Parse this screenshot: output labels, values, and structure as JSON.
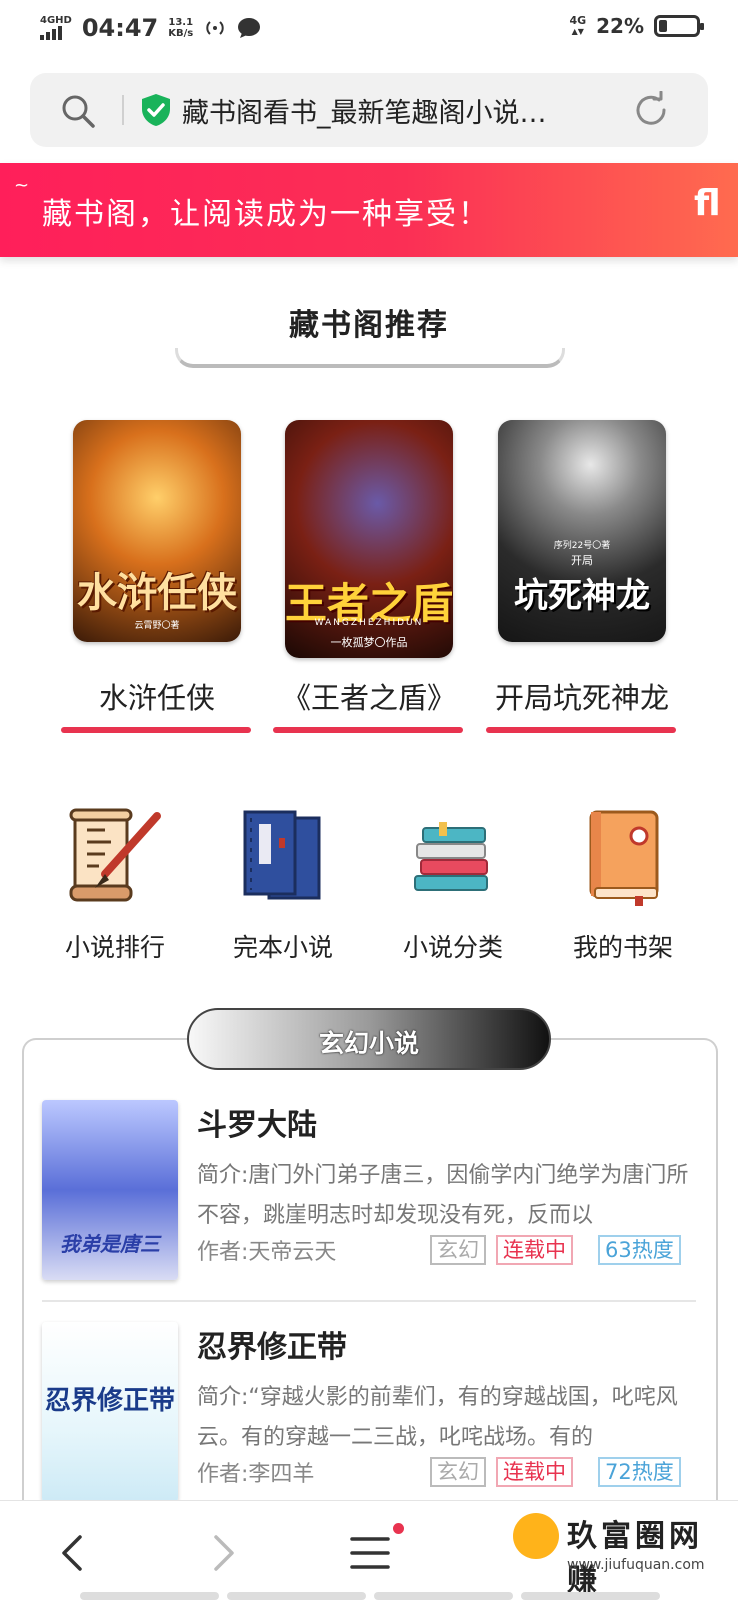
{
  "status_bar": {
    "network_label": "4GHD",
    "time": "04:47",
    "speed_value": "13.1",
    "speed_unit": "KB/s",
    "network_right": "4G",
    "battery_pct": "22%"
  },
  "address_bar": {
    "title": "藏书阁看书_最新笔趣阁小说…"
  },
  "banner": {
    "tilde": "~",
    "text": "藏书阁，让阅读成为一种享受！",
    "icon_glyph": "fl"
  },
  "recommend": {
    "title": "藏书阁推荐",
    "books": [
      {
        "cover_title": "水浒任侠",
        "cover_author": "云霄野〇著",
        "name": "水浒任侠"
      },
      {
        "cover_title": "王者之盾",
        "cover_author": "一枚孤梦〇作品",
        "cover_sub": "WANGZHEZHIDUN",
        "name": "《王者之盾》"
      },
      {
        "cover_title": "坑死神龙",
        "cover_author": "序列22号〇著",
        "cover_sub": "开局",
        "name": "开局坑死神龙"
      }
    ]
  },
  "quick_menu": [
    {
      "label": "小说排行",
      "icon": "scroll-brush-icon"
    },
    {
      "label": "完本小说",
      "icon": "thread-bound-books-icon"
    },
    {
      "label": "小说分类",
      "icon": "book-stack-icon"
    },
    {
      "label": "我的书架",
      "icon": "bookshelf-notebook-icon"
    }
  ],
  "category": {
    "title": "玄幻小说",
    "books": [
      {
        "title": "斗罗大陆",
        "intro": "简介:唐门外门弟子唐三，因偷学内门绝学为唐门所不容，跳崖明志时却发现没有死，反而以",
        "author": "作者:天帝云天",
        "genre": "玄幻",
        "status": "连载中",
        "heat": "63热度",
        "cover_text": "我弟是唐三"
      },
      {
        "title": "忍界修正带",
        "intro": "简介:“穿越火影的前辈们，有的穿越战国，叱咤风云。有的穿越一二三战，叱咤战场。有的",
        "author": "作者:李四羊",
        "genre": "玄幻",
        "status": "连载中",
        "heat": "72热度",
        "cover_text": "忍界修正带"
      }
    ]
  },
  "watermark": {
    "text": "玖富圈网赚",
    "url": "www.jiufuquan.com"
  },
  "colors": {
    "accent": "#e8334f",
    "banner_start": "#ff1f5a",
    "banner_end": "#ff6b4f",
    "heat_tag": "#4aa3d8"
  }
}
